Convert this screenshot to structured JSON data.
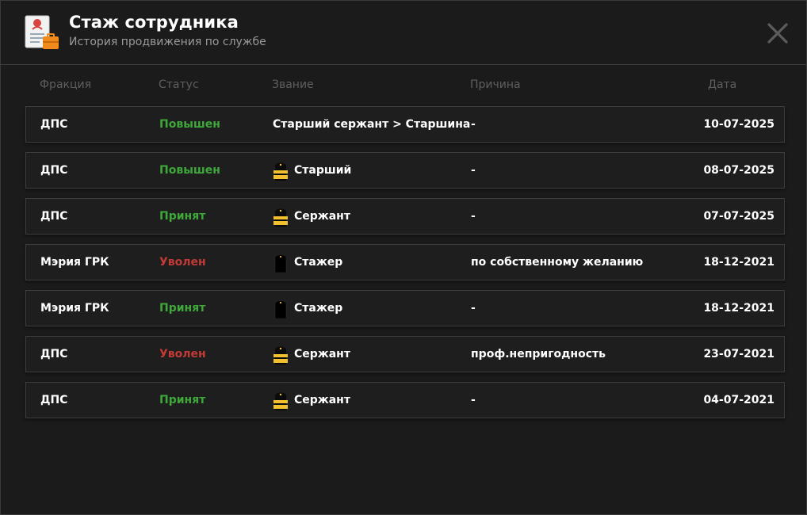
{
  "header": {
    "title": "Стаж сотрудника",
    "subtitle": "История продвижения по службе"
  },
  "columns": {
    "faction": "Фракция",
    "status": "Статус",
    "rank": "Звание",
    "reason": "Причина",
    "date": "Дата"
  },
  "colors": {
    "promoted": "#3fa83a",
    "hired": "#3fa83a",
    "fired": "#c13a36",
    "rank_gold": "#f2c02f"
  },
  "rows": [
    {
      "faction": "ДПС",
      "status": "Повышен",
      "status_kind": "promoted",
      "rank": "Старший сержант > Старшина",
      "rank_icon": "none",
      "reason": "-",
      "date": "10-07-2025"
    },
    {
      "faction": "ДПС",
      "status": "Повышен",
      "status_kind": "promoted",
      "rank": "Старший",
      "rank_icon": "gold-shoulder-strap-icon",
      "reason": "-",
      "date": "08-07-2025"
    },
    {
      "faction": "ДПС",
      "status": "Принят",
      "status_kind": "hired",
      "rank": "Сержант",
      "rank_icon": "gold-shoulder-strap-icon",
      "reason": "-",
      "date": "07-07-2025"
    },
    {
      "faction": "Мэрия ГРК",
      "status": "Уволен",
      "status_kind": "fired",
      "rank": "Стажер",
      "rank_icon": "black-shoulder-strap-icon",
      "reason": "по собственному желанию",
      "date": "18-12-2021"
    },
    {
      "faction": "Мэрия ГРК",
      "status": "Принят",
      "status_kind": "hired",
      "rank": "Стажер",
      "rank_icon": "black-shoulder-strap-icon",
      "reason": "-",
      "date": "18-12-2021"
    },
    {
      "faction": "ДПС",
      "status": "Уволен",
      "status_kind": "fired",
      "rank": "Сержант",
      "rank_icon": "gold-shoulder-strap-icon",
      "reason": "проф.непригодность",
      "date": "23-07-2021"
    },
    {
      "faction": "ДПС",
      "status": "Принят",
      "status_kind": "hired",
      "rank": "Сержант",
      "rank_icon": "gold-shoulder-strap-icon",
      "reason": "-",
      "date": "04-07-2021"
    }
  ]
}
